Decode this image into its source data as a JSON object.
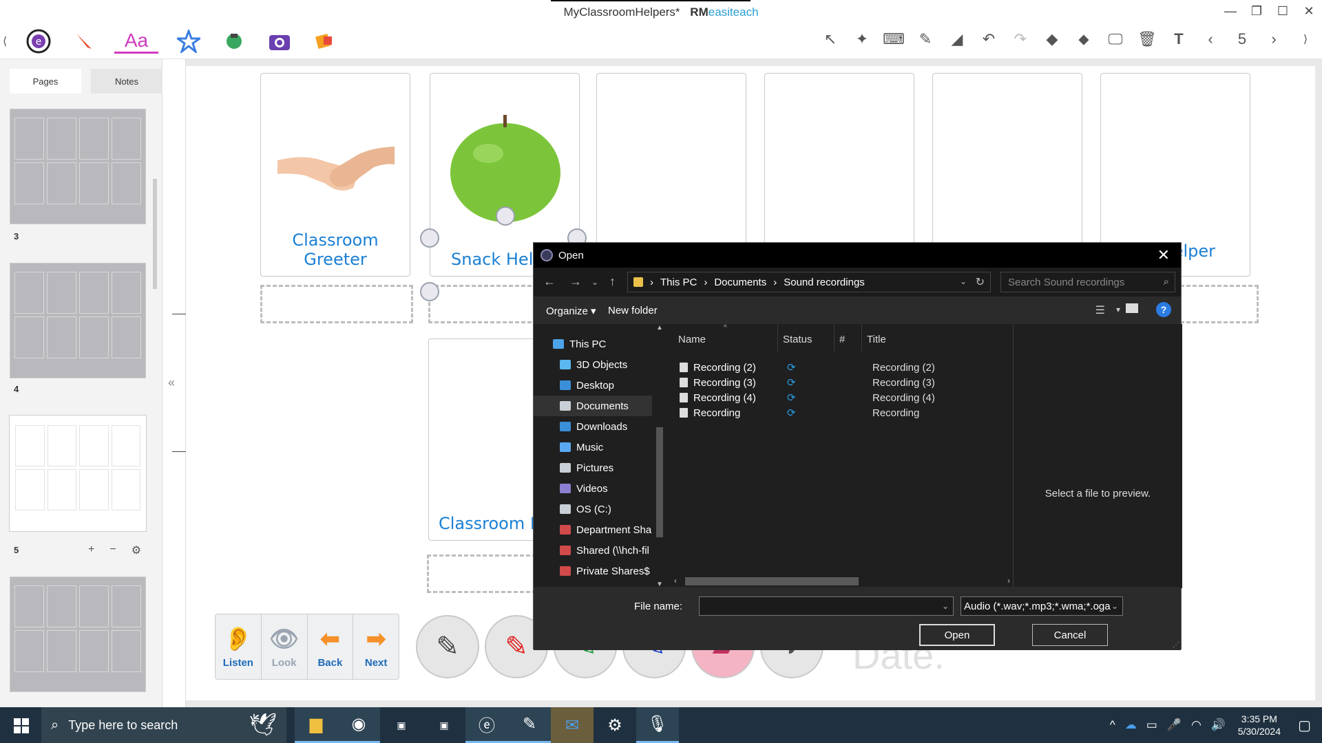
{
  "window": {
    "title": "MyClassroomHelpers*",
    "brand_a": "RM",
    "brand_b": "easiteach",
    "min": "—",
    "restore": "❐",
    "max": "☐",
    "close": "✕"
  },
  "toolbar": {
    "text_tool": "Aa",
    "page_counter": "5"
  },
  "left_panel": {
    "tabs": [
      "Pages",
      "Notes"
    ],
    "pages": [
      {
        "num": "3"
      },
      {
        "num": "4"
      },
      {
        "num": "5"
      },
      {
        "num": ""
      }
    ],
    "add": "+",
    "remove": "−",
    "settings": "⚙",
    "collapse": "«"
  },
  "canvas": {
    "cards": [
      {
        "label": "Classroom Greeter"
      },
      {
        "label": "Snack Help"
      },
      {
        "label": ""
      },
      {
        "label": ""
      },
      {
        "label": ""
      },
      {
        "label": "Helper"
      },
      {
        "label": "Classroom H"
      }
    ],
    "tray": [
      {
        "label": "Listen",
        "icon": "👂"
      },
      {
        "label": "Look",
        "icon": "👁"
      },
      {
        "label": "Back",
        "icon": "⬅"
      },
      {
        "label": "Next",
        "icon": "➡"
      }
    ],
    "date_text": "Date."
  },
  "dialog": {
    "title": "Open",
    "close": "✕",
    "path": [
      "This PC",
      "Documents",
      "Sound recordings"
    ],
    "search_placeholder": "Search Sound recordings",
    "organize": "Organize ▾",
    "new_folder": "New folder",
    "help": "?",
    "nav_items": [
      {
        "label": "This PC",
        "color": "#4da3e8"
      },
      {
        "label": "3D Objects",
        "color": "#5bb8ef"
      },
      {
        "label": "Desktop",
        "color": "#3a8fd8"
      },
      {
        "label": "Documents",
        "color": "#c9cfd6"
      },
      {
        "label": "Downloads",
        "color": "#3a8fd8"
      },
      {
        "label": "Music",
        "color": "#5aa8f0"
      },
      {
        "label": "Pictures",
        "color": "#c9cfd6"
      },
      {
        "label": "Videos",
        "color": "#8a7fd0"
      },
      {
        "label": "OS (C:)",
        "color": "#c9cfd6"
      },
      {
        "label": "Department Sha",
        "color": "#d04a4a"
      },
      {
        "label": "Shared (\\\\hch-fil",
        "color": "#d04a4a"
      },
      {
        "label": "Private Shares$ (",
        "color": "#d04a4a"
      }
    ],
    "columns": [
      "Name",
      "Status",
      "#",
      "Title"
    ],
    "files": [
      {
        "name": "Recording (2)",
        "status": "⟳",
        "title": "Recording (2)"
      },
      {
        "name": "Recording (3)",
        "status": "⟳",
        "title": "Recording (3)"
      },
      {
        "name": "Recording (4)",
        "status": "⟳",
        "title": "Recording (4)"
      },
      {
        "name": "Recording",
        "status": "⟳",
        "title": "Recording"
      }
    ],
    "preview_text": "Select a file to preview.",
    "file_name_label": "File name:",
    "file_name_value": "",
    "filter": "Audio (*.wav;*.mp3;*.wma;*.oga",
    "open_button": "Open",
    "cancel_button": "Cancel"
  },
  "taskbar": {
    "search_placeholder": "Type here to search",
    "time": "3:35 PM",
    "date": "5/30/2024"
  }
}
